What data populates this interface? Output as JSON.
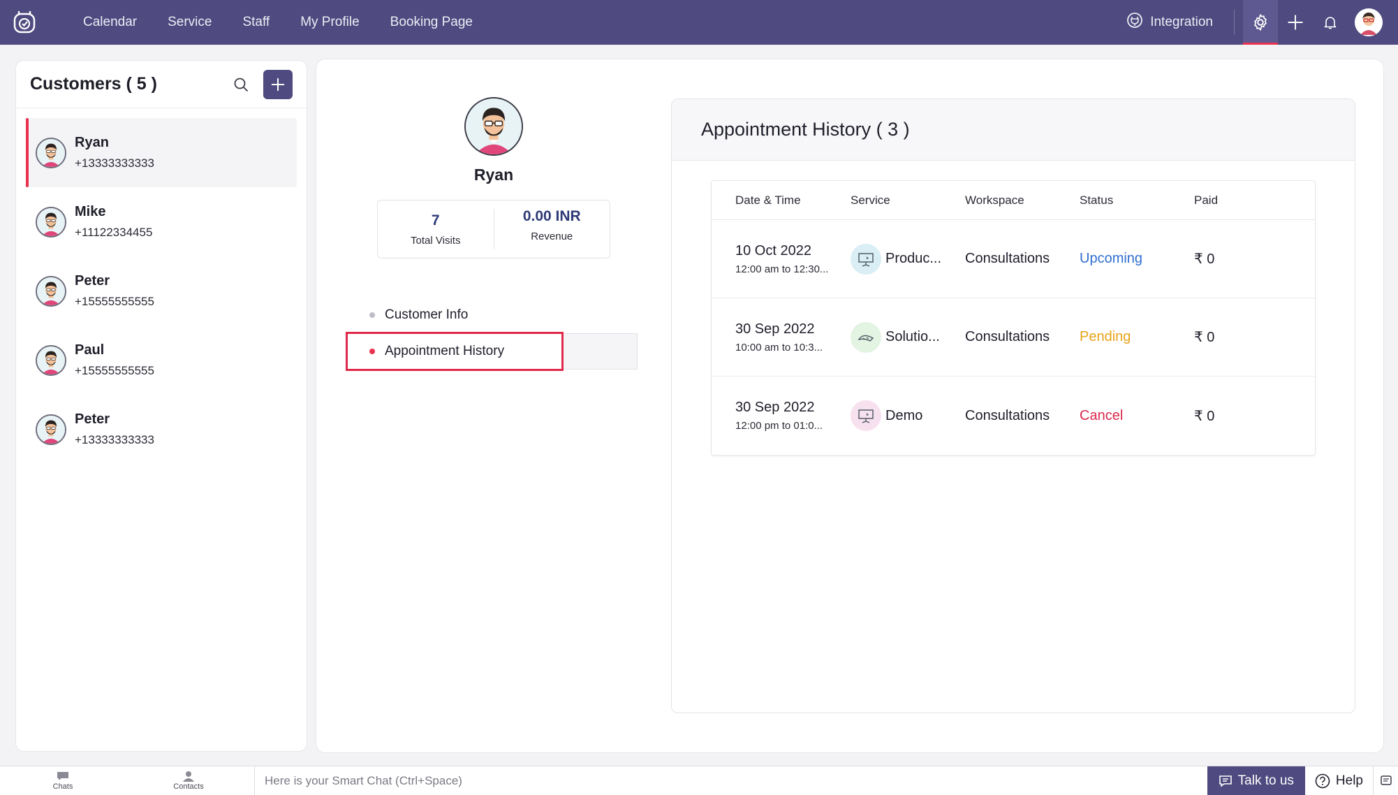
{
  "topbar": {
    "nav": [
      "Calendar",
      "Service",
      "Staff",
      "My Profile",
      "Booking Page"
    ],
    "integration_label": "Integration"
  },
  "customers": {
    "title": "Customers ( 5 )",
    "items": [
      {
        "name": "Ryan",
        "phone": "+13333333333"
      },
      {
        "name": "Mike",
        "phone": "+11122334455"
      },
      {
        "name": "Peter",
        "phone": "+15555555555"
      },
      {
        "name": "Paul",
        "phone": "+15555555555"
      },
      {
        "name": "Peter",
        "phone": "+13333333333"
      }
    ]
  },
  "profile": {
    "name": "Ryan",
    "total_visits_value": "7",
    "total_visits_label": "Total Visits",
    "revenue_value": "0.00 INR",
    "revenue_label": "Revenue",
    "nav": [
      "Customer Info",
      "Appointment History"
    ]
  },
  "history": {
    "title": "Appointment History ( 3 )",
    "columns": [
      "Date & Time",
      "Service",
      "Workspace",
      "Status",
      "Paid"
    ],
    "rows": [
      {
        "date": "10 Oct 2022",
        "time": "12:00 am to 12:30...",
        "service": "Produc...",
        "workspace": "Consultations",
        "status": "Upcoming",
        "status_color": "#2f6fd0",
        "paid": "₹ 0",
        "icon_bg": "#d9eef5"
      },
      {
        "date": "30 Sep 2022",
        "time": "10:00 am to 10:3...",
        "service": "Solutio...",
        "workspace": "Consultations",
        "status": "Pending",
        "status_color": "#e8a317",
        "paid": "₹ 0",
        "icon_bg": "#e3f4e3"
      },
      {
        "date": "30 Sep 2022",
        "time": "12:00 pm to 01:0...",
        "service": "Demo",
        "workspace": "Consultations",
        "status": "Cancel",
        "status_color": "#d92a4b",
        "paid": "₹ 0",
        "icon_bg": "#f8e1ef"
      }
    ]
  },
  "bottombar": {
    "chats_label": "Chats",
    "contacts_label": "Contacts",
    "smart_chat_placeholder": "Here is your Smart Chat (Ctrl+Space)",
    "talk_label": "Talk to us",
    "help_label": "Help"
  },
  "colors": {
    "brand": "#4f4a7f",
    "accent": "#e8324e"
  }
}
